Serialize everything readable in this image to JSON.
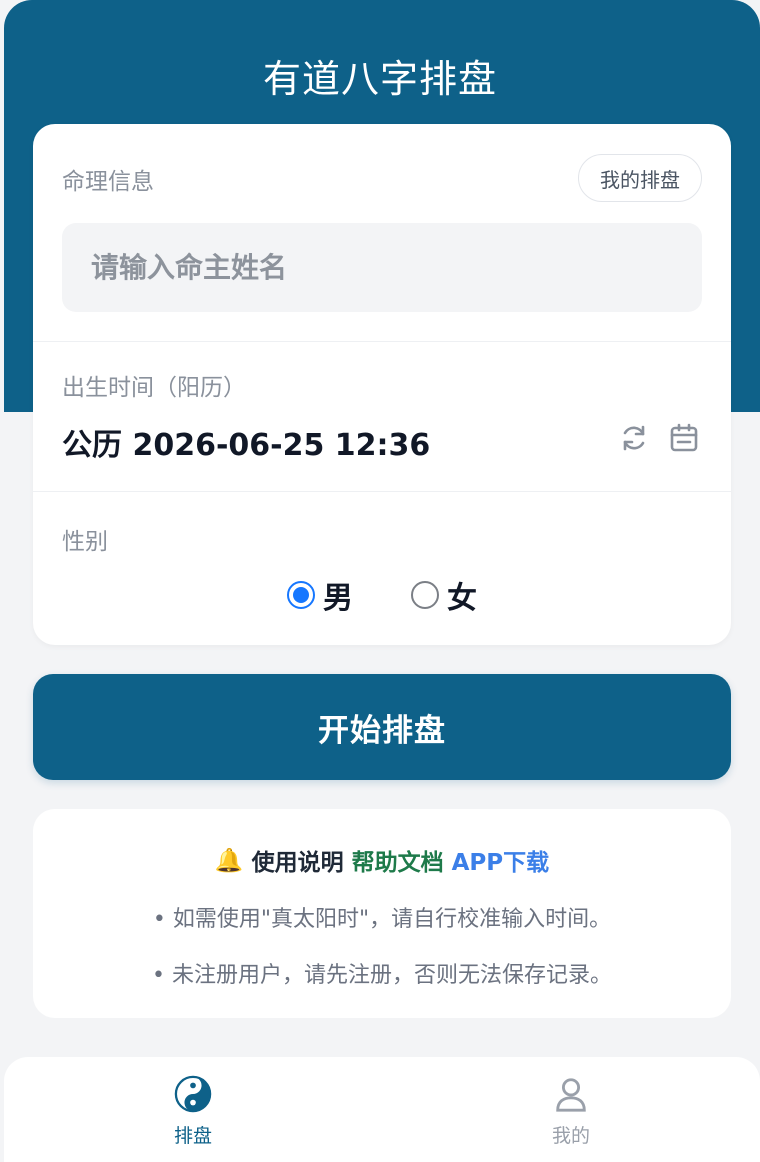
{
  "header": {
    "title": "有道八字排盘"
  },
  "form": {
    "info_label": "命理信息",
    "my_chart_label": "我的排盘",
    "name_placeholder": "请输入命主姓名",
    "name_value": "",
    "birth_label": "出生时间（阳历）",
    "birth_value": "公历 2026-06-25 12:36",
    "refresh_icon": "refresh-icon",
    "calendar_icon": "calendar-icon",
    "gender_label": "性别",
    "gender_options": [
      {
        "label": "男",
        "checked": true
      },
      {
        "label": "女",
        "checked": false
      }
    ]
  },
  "actions": {
    "start_label": "开始排盘"
  },
  "notes": {
    "bell_icon": "🔔",
    "title": "使用说明",
    "help_link": "帮助文档",
    "app_link": "APP下载",
    "items": [
      "• 如需使用\"真太阳时\"，请自行校准输入时间。",
      "• 未注册用户，请先注册，否则无法保存记录。"
    ]
  },
  "tabbar": {
    "items": [
      {
        "label": "排盘",
        "icon": "yin-yang-icon",
        "active": true
      },
      {
        "label": "我的",
        "icon": "user-icon",
        "active": false
      }
    ]
  },
  "colors": {
    "brand": "#0e6189",
    "radio_active": "#1677ff",
    "help_link": "#1e7a4a",
    "app_link": "#3b7fe8"
  }
}
